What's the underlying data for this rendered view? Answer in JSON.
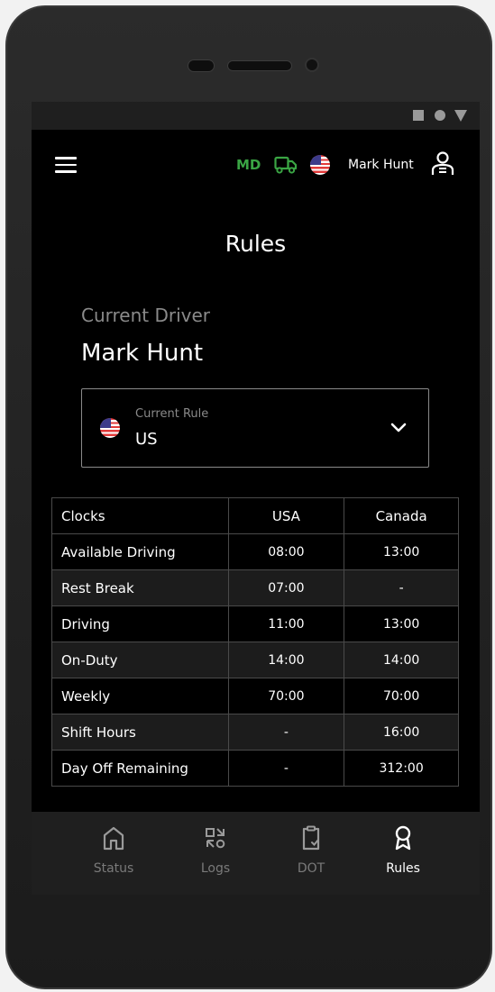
{
  "header": {
    "md_badge": "MD",
    "user_name": "Mark Hunt",
    "accent_color": "#3aa544"
  },
  "page": {
    "title": "Rules"
  },
  "driver": {
    "label": "Current Driver",
    "name": "Mark Hunt"
  },
  "rule": {
    "label": "Current Rule",
    "value": "US"
  },
  "table": {
    "headers": [
      "Clocks",
      "USA",
      "Canada"
    ],
    "rows": [
      [
        "Available Driving",
        "08:00",
        "13:00"
      ],
      [
        "Rest Break",
        "07:00",
        "-"
      ],
      [
        "Driving",
        "11:00",
        "13:00"
      ],
      [
        "On-Duty",
        "14:00",
        "14:00"
      ],
      [
        "Weekly",
        "70:00",
        "70:00"
      ],
      [
        "Shift Hours",
        "-",
        "16:00"
      ],
      [
        "Day Off Remaining",
        "-",
        "312:00"
      ]
    ]
  },
  "nav": {
    "items": [
      {
        "label": "Status",
        "icon": "home-icon"
      },
      {
        "label": "Logs",
        "icon": "logs-icon"
      },
      {
        "label": "DOT",
        "icon": "clipboard-check-icon"
      },
      {
        "label": "Rules",
        "icon": "award-icon"
      }
    ],
    "active": "Rules"
  }
}
